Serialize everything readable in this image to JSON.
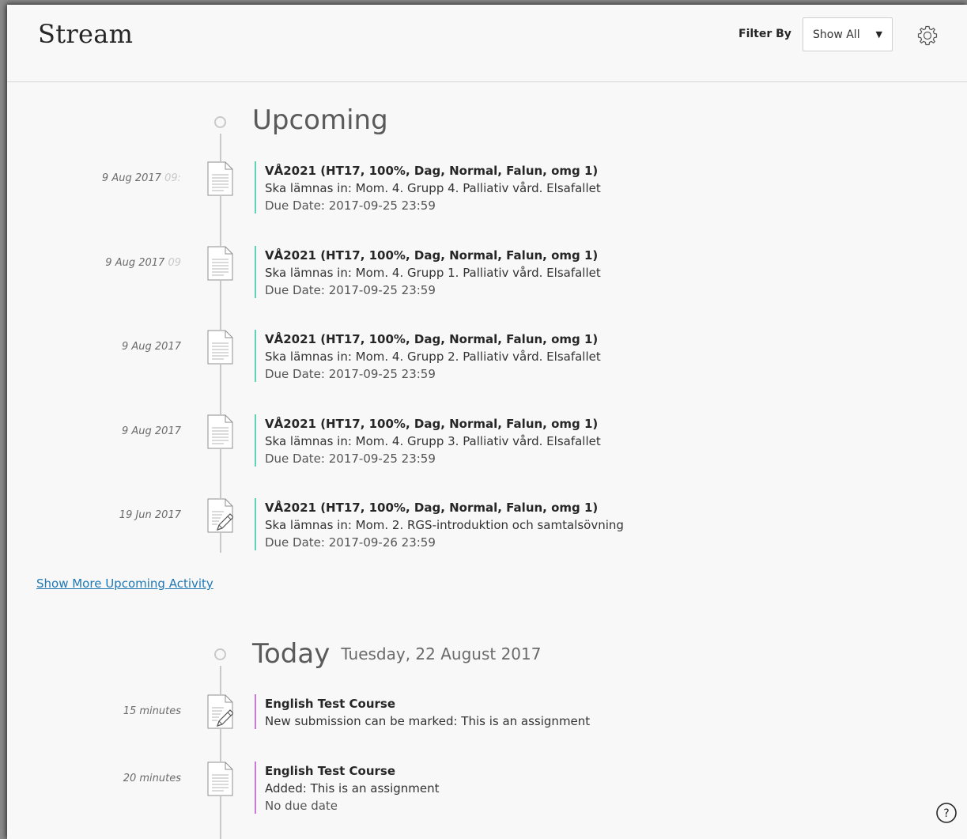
{
  "header": {
    "title": "Stream",
    "filter_label": "Filter By",
    "filter_value": "Show All"
  },
  "upcoming": {
    "title": "Upcoming",
    "items": [
      {
        "time": "9 Aug 2017",
        "time_faded": "09:",
        "course": "VÅ2021 (HT17, 100%, Dag, Normal, Falun, omg 1)",
        "desc": "Ska lämnas in: Mom. 4. Grupp 4. Palliativ vård. Elsafallet",
        "due": "Due Date: 2017-09-25 23:59",
        "icon": "document-icon"
      },
      {
        "time": "9 Aug 2017",
        "time_faded": "09",
        "course": "VÅ2021 (HT17, 100%, Dag, Normal, Falun, omg 1)",
        "desc": "Ska lämnas in: Mom. 4. Grupp 1. Palliativ vård. Elsafallet",
        "due": "Due Date: 2017-09-25 23:59",
        "icon": "document-icon"
      },
      {
        "time": "9 Aug 2017",
        "time_faded": "",
        "course": "VÅ2021 (HT17, 100%, Dag, Normal, Falun, omg 1)",
        "desc": "Ska lämnas in: Mom. 4. Grupp 2. Palliativ vård. Elsafallet",
        "due": "Due Date: 2017-09-25 23:59",
        "icon": "document-icon"
      },
      {
        "time": "9 Aug 2017",
        "time_faded": "",
        "course": "VÅ2021 (HT17, 100%, Dag, Normal, Falun, omg 1)",
        "desc": "Ska lämnas in: Mom. 4. Grupp 3. Palliativ vård. Elsafallet",
        "due": "Due Date: 2017-09-25 23:59",
        "icon": "document-icon"
      },
      {
        "time": "19 Jun 2017",
        "time_faded": "",
        "course": "VÅ2021 (HT17, 100%, Dag, Normal, Falun, omg 1)",
        "desc": "Ska lämnas in: Mom. 2. RGS-introduktion och samtalsövning",
        "due": "Due Date: 2017-09-26 23:59",
        "icon": "document-pencil-icon"
      }
    ],
    "show_more": "Show More Upcoming Activity"
  },
  "today": {
    "title": "Today",
    "date": "Tuesday, 22 August 2017",
    "items": [
      {
        "time": "15 minutes",
        "course": "English Test Course",
        "desc": "New submission can be marked: This is an assignment",
        "due": "",
        "icon": "document-pencil-icon"
      },
      {
        "time": "20 minutes",
        "course": "English Test Course",
        "desc": "Added: This is an assignment",
        "due": "No due date",
        "icon": "document-icon"
      }
    ]
  },
  "colors": {
    "upcoming_accent": "#5fd3b3",
    "today_accent": "#c57ad6",
    "link": "#1f78b4"
  }
}
